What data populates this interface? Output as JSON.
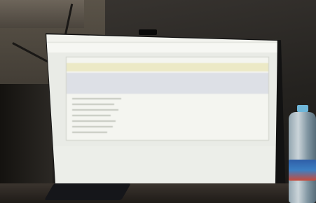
{
  "scene": {
    "description_type": "photo",
    "colors": {
      "screen": "#e9ebe6",
      "header_band": "#ece9c6",
      "selection_band": "#dde0e6",
      "bezel": "#121212",
      "bottle_cap": "#6fb6d8",
      "bottle_label": "#2f5fa8"
    }
  }
}
